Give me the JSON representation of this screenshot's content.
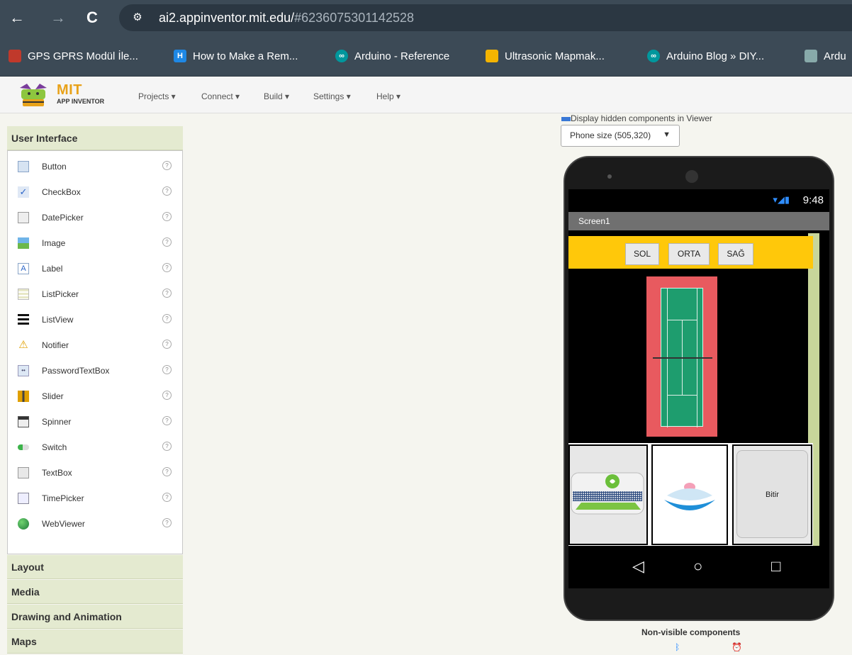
{
  "browser": {
    "url_host": "ai2.appinventor.mit.edu/",
    "url_rest": "#6236075301142528",
    "bookmarks": [
      {
        "label": "GPS GPRS Modül İle...",
        "icon": "brain-icon",
        "color": "#c0392b"
      },
      {
        "label": "How to Make a Rem...",
        "icon": "hackster-icon",
        "color": "#1e88e5"
      },
      {
        "label": "Arduino - Reference",
        "icon": "arduino-icon",
        "color": "#00979d"
      },
      {
        "label": "Ultrasonic Mapmak...",
        "icon": "instructables-icon",
        "color": "#f4b400"
      },
      {
        "label": "Arduino Blog » DIY...",
        "icon": "arduino-icon",
        "color": "#00979d"
      },
      {
        "label": "Ardu",
        "icon": "folder-icon",
        "color": "#8aa"
      }
    ]
  },
  "header": {
    "logo_title": "MIT",
    "logo_subtitle": "APP INVENTOR",
    "menus": [
      "Projects ▾",
      "Connect ▾",
      "Build ▾",
      "Settings ▾",
      "Help ▾"
    ]
  },
  "palette": {
    "section_title": "User Interface",
    "items": [
      {
        "label": "Button",
        "icon": "button-icon",
        "help": "?"
      },
      {
        "label": "CheckBox",
        "icon": "checkbox-icon",
        "help": "?"
      },
      {
        "label": "DatePicker",
        "icon": "datepicker-icon",
        "help": "?"
      },
      {
        "label": "Image",
        "icon": "image-icon",
        "help": "?"
      },
      {
        "label": "Label",
        "icon": "label-icon",
        "help": "?"
      },
      {
        "label": "ListPicker",
        "icon": "listpicker-icon",
        "help": "?"
      },
      {
        "label": "ListView",
        "icon": "listview-icon",
        "help": "?"
      },
      {
        "label": "Notifier",
        "icon": "notifier-icon",
        "help": "?"
      },
      {
        "label": "PasswordTextBox",
        "icon": "password-icon",
        "help": "?"
      },
      {
        "label": "Slider",
        "icon": "slider-icon",
        "help": "?"
      },
      {
        "label": "Spinner",
        "icon": "spinner-icon",
        "help": "?"
      },
      {
        "label": "Switch",
        "icon": "switch-icon",
        "help": "?"
      },
      {
        "label": "TextBox",
        "icon": "textbox-icon",
        "help": "?"
      },
      {
        "label": "TimePicker",
        "icon": "timepicker-icon",
        "help": "?"
      },
      {
        "label": "WebViewer",
        "icon": "webviewer-icon",
        "help": "?"
      }
    ],
    "other_sections": [
      "Layout",
      "Media",
      "Drawing and Animation",
      "Maps"
    ]
  },
  "viewer": {
    "hidden_components_label": "Display hidden components in Viewer",
    "phone_size": "Phone size (505,320)",
    "status_time": "9:48",
    "screen_title": "Screen1",
    "buttons": [
      "SOL",
      "ORTA",
      "SAĞ"
    ],
    "finish_button": "Bitir",
    "non_visible_title": "Non-visible components"
  }
}
